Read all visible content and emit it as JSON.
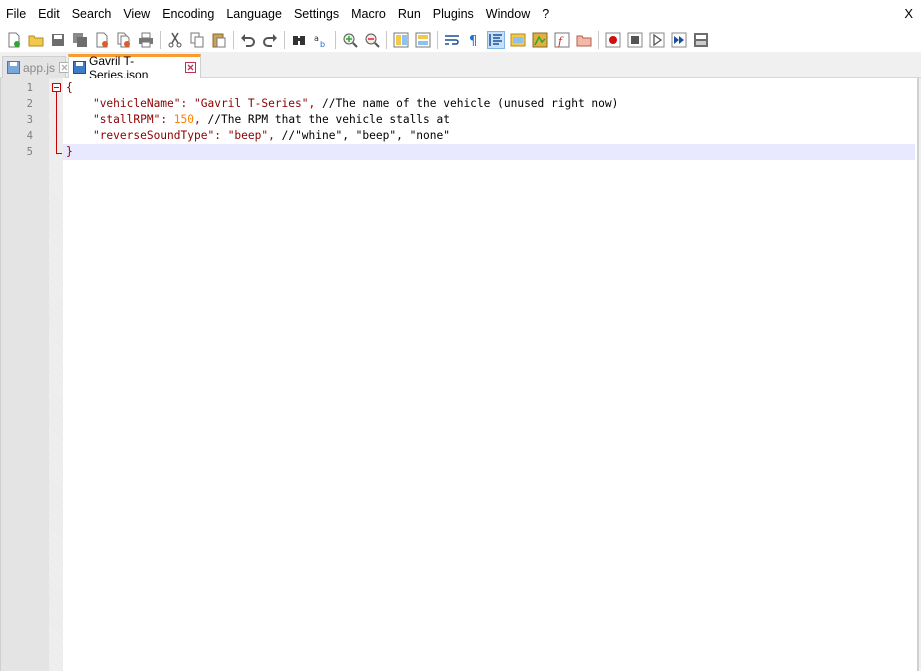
{
  "menu": {
    "items": [
      "File",
      "Edit",
      "Search",
      "View",
      "Encoding",
      "Language",
      "Settings",
      "Macro",
      "Run",
      "Plugins",
      "Window",
      "?"
    ],
    "close": "X"
  },
  "toolbar": {
    "icons": [
      "new-file-icon",
      "open-file-icon",
      "save-icon",
      "save-all-icon",
      "close-icon",
      "close-all-icon",
      "print-icon",
      "cut-icon",
      "copy-icon",
      "paste-icon",
      "undo-icon",
      "redo-icon",
      "find-icon",
      "replace-icon",
      "zoom-in-icon",
      "zoom-out-icon",
      "sync-vertical-icon",
      "sync-horizontal-icon",
      "word-wrap-icon",
      "show-all-chars-icon",
      "indent-guide-icon",
      "user-lang-icon",
      "doc-map-icon",
      "function-list-icon",
      "folder-workspace-icon",
      "record-macro-icon",
      "stop-record-icon",
      "play-macro-icon",
      "run-macro-multiple-icon",
      "save-macro-icon"
    ],
    "active": "indent-guide-icon"
  },
  "tabs": [
    {
      "label": "app.js",
      "active": false
    },
    {
      "label": "Gavril T-Series.json",
      "active": true
    }
  ],
  "editor": {
    "line_numbers": [
      "1",
      "2",
      "3",
      "4",
      "5"
    ],
    "caret_line": 5,
    "lines": [
      {
        "t1": "{"
      },
      {
        "indent": "    ",
        "key": "\"vehicleName\"",
        "colon": ": ",
        "val": "\"Gavril T-Series\"",
        "comma": ", ",
        "comment": "//The name of the vehicle (unused right now)"
      },
      {
        "indent": "    ",
        "key": "\"stallRPM\"",
        "colon": ": ",
        "num": "150",
        "comma": ", ",
        "comment": "//The RPM that the vehicle stalls at"
      },
      {
        "indent": "    ",
        "key": "\"reverseSoundType\"",
        "colon": ": ",
        "val": "\"beep\"",
        "comma": ", ",
        "comment": "//\"whine\", \"beep\", \"none\""
      },
      {
        "t1": "}"
      }
    ]
  }
}
